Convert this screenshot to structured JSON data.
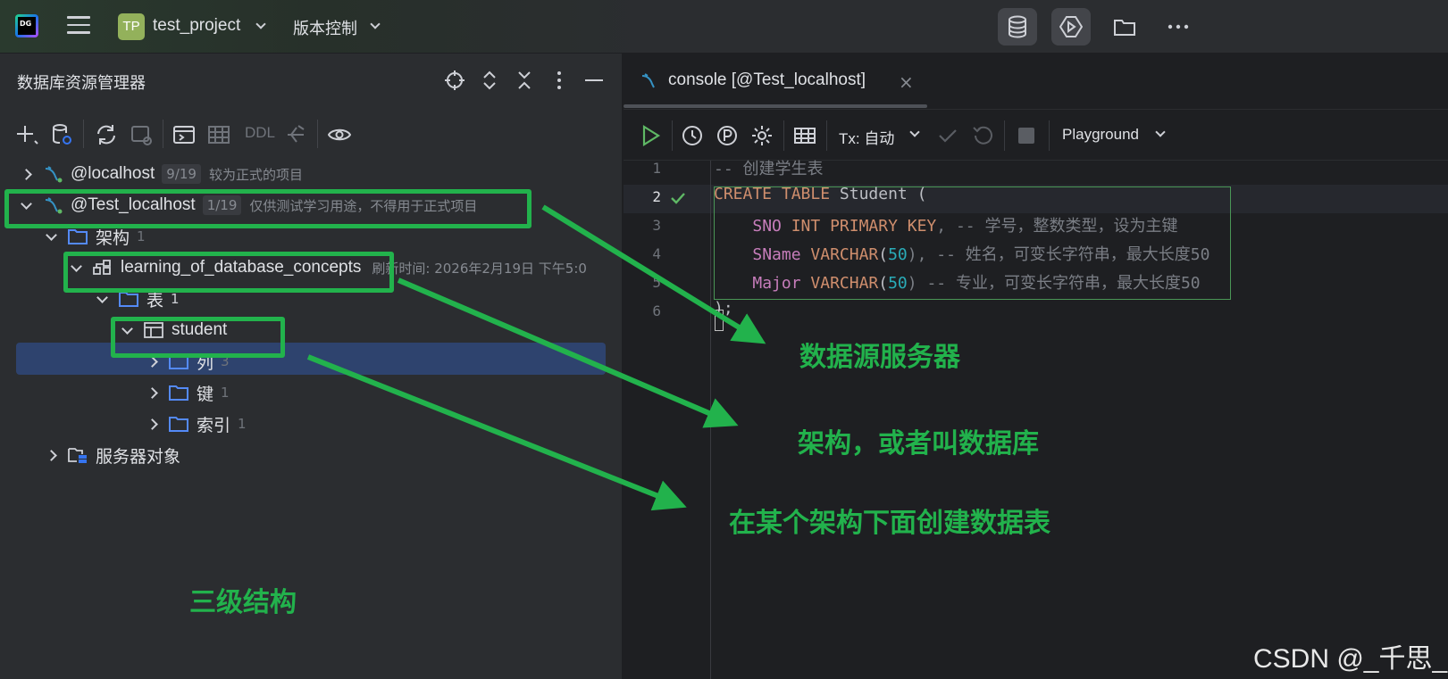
{
  "app": {
    "logo_text": "DG",
    "project_badge": "TP",
    "project_name": "test_project",
    "vcs_label": "版本控制"
  },
  "top_toolbar": {
    "icons": [
      "database-icon",
      "run-services-icon",
      "folder-icon",
      "more-icon"
    ]
  },
  "explorer": {
    "title": "数据库资源管理器",
    "toolbar": {
      "ddl_label": "DDL"
    },
    "tree": [
      {
        "label": "@localhost",
        "count": "9/19",
        "comment": "较为正式的项目"
      },
      {
        "label": "@Test_localhost",
        "count": "1/19",
        "comment": "仅供测试学习用途，不得用于正式项目"
      },
      {
        "label": "架构",
        "count": "1"
      },
      {
        "label": "learning_of_database_concepts",
        "comment": "刷新时间: 2026年2月19日 下午5:0"
      },
      {
        "label": "表",
        "count": "1"
      },
      {
        "label": "student"
      },
      {
        "label": "列",
        "count": "3"
      },
      {
        "label": "键",
        "count": "1"
      },
      {
        "label": "索引",
        "count": "1"
      },
      {
        "label": "服务器对象"
      }
    ]
  },
  "editor": {
    "tab_label": "console [@Test_localhost]",
    "toolbar": {
      "tx_label": "Tx: 自动",
      "mode_label": "Playground"
    },
    "line_numbers": [
      "1",
      "2",
      "3",
      "4",
      "5",
      "6"
    ],
    "code": {
      "l1": "-- 创建学生表",
      "l2_kw1": "CREATE",
      "l2_kw2": "TABLE",
      "l2_rest": " Student (",
      "l3_field": "SNO",
      "l3_type": "INT PRIMARY KEY",
      "l3_comment": ", -- 学号，整数类型，设为主键",
      "l4_field": "SName",
      "l4_type": "VARCHAR",
      "l4_num": "50",
      "l4_comment": "), -- 姓名，可变长字符串，最大长度50",
      "l5_field": "Major",
      "l5_type": "VARCHAR",
      "l5_num": "50",
      "l5_comment": ") -- 专业，可变长字符串，最大长度50",
      "l6": ");"
    }
  },
  "annotations": {
    "server": "数据源服务器",
    "schema": "架构，或者叫数据库",
    "table": "在某个架构下面创建数据表",
    "three_levels": "三级结构",
    "color": "#22b24c"
  },
  "watermark": "CSDN @_千思_"
}
